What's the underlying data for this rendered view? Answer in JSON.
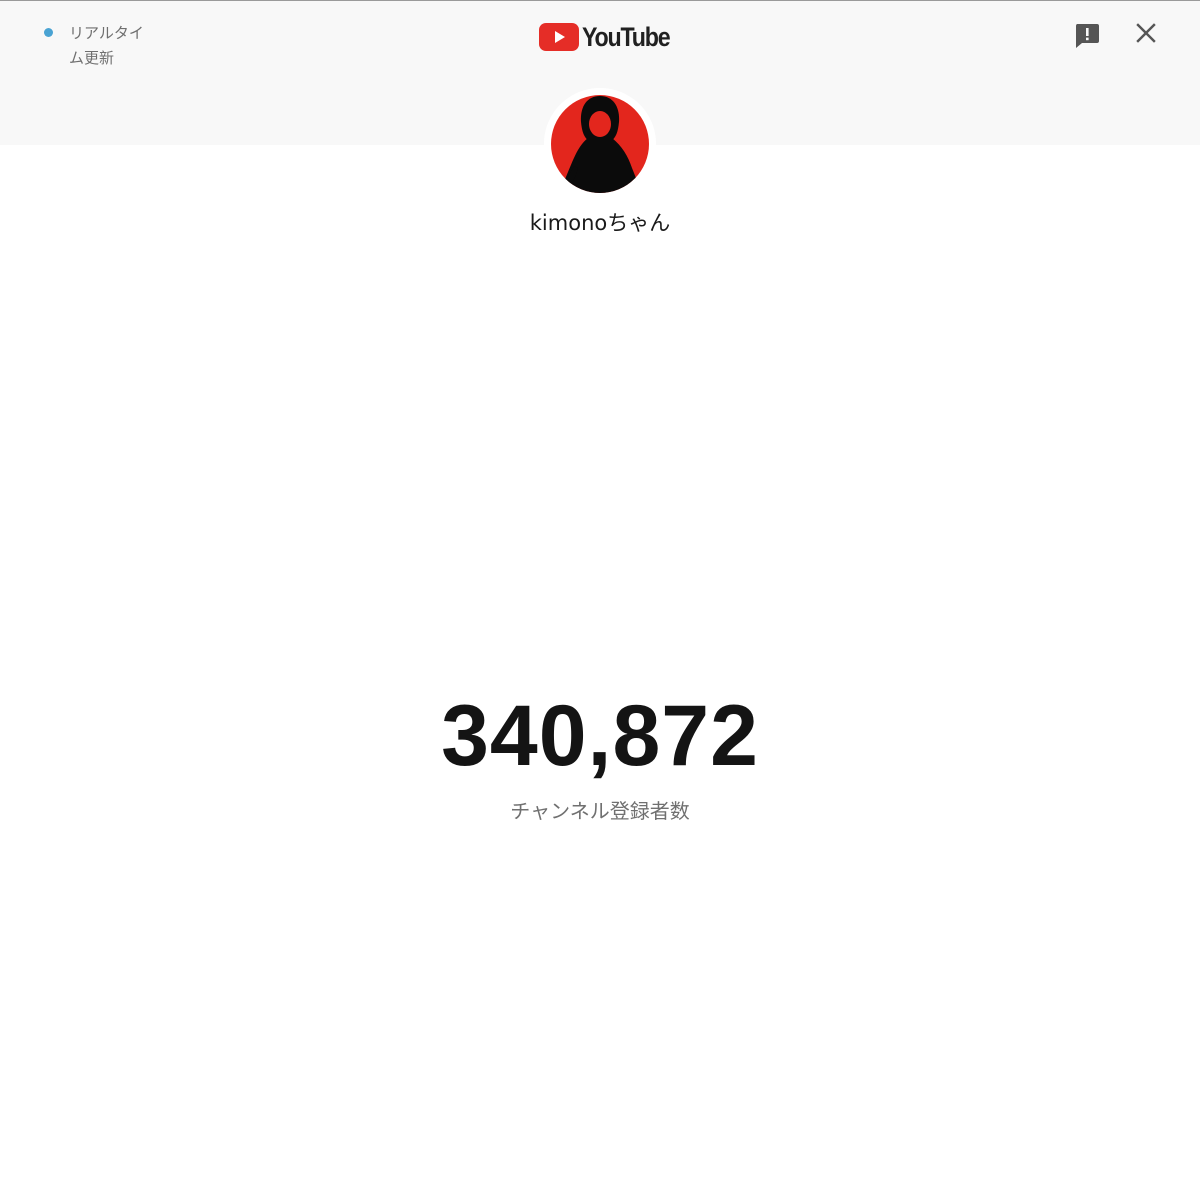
{
  "header": {
    "live_indicator": {
      "label": "リアルタイム更新",
      "dot_color": "#4aa3d3"
    },
    "logo": {
      "text": "YouTube",
      "icon": "youtube-play-icon",
      "brand_color": "#e52d27"
    },
    "feedback_icon": "feedback-icon",
    "close_icon": "close-icon"
  },
  "channel": {
    "avatar_icon": "channel-avatar",
    "avatar_color": "#e3261d",
    "name": "kimonoちゃん"
  },
  "stats": {
    "subscriber_count": "340,872",
    "subscriber_label": "チャンネル登録者数"
  }
}
